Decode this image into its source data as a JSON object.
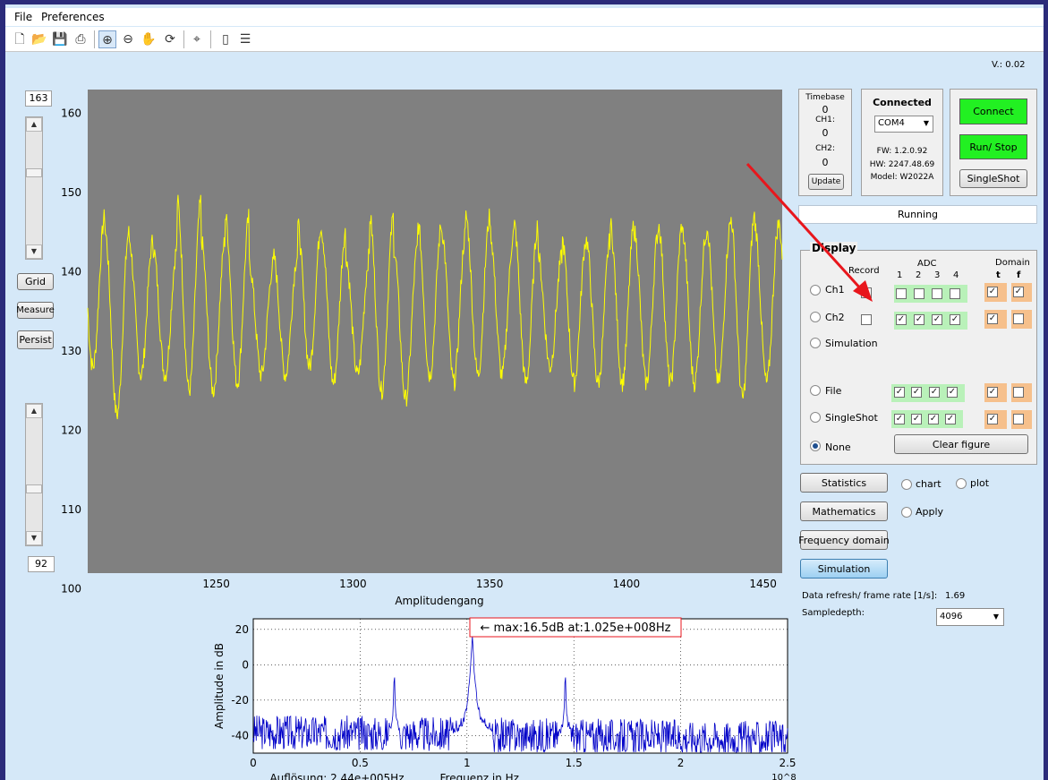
{
  "menu": [
    "File",
    "Preferences"
  ],
  "toolbar_icons": [
    "new-file-icon",
    "open-folder-icon",
    "save-icon",
    "print-icon",
    "zoom-in-icon",
    "zoom-out-icon",
    "pan-hand-icon",
    "rotate-3d-icon",
    "data-cursor-icon",
    "colorbar-icon",
    "legend-icon"
  ],
  "version": "V.: 0.02",
  "left": {
    "top_value": "163",
    "bottom_value": "92",
    "grid_label": "Grid",
    "measure_label": "Measure",
    "persist_label": "Persist"
  },
  "status": {
    "timebase_title": "Timebase",
    "timebase_value": "0",
    "ch1_label": "CH1:",
    "ch1_value": "0",
    "ch2_label": "CH2:",
    "ch2_value": "0",
    "update_label": "Update",
    "connected_label": "Connected",
    "port_value": "COM4",
    "fw": "FW: 1.2.0.92",
    "hw": "HW: 2247.48.69",
    "model": "Model: W2022A",
    "connect_label": "Connect",
    "runstop_label": "Run/ Stop",
    "singleshot_label": "SingleShot",
    "running_text": "Running"
  },
  "display": {
    "title": "Display",
    "record_header": "Record",
    "adc_header": "ADC",
    "adc_cols": [
      "1",
      "2",
      "3",
      "4"
    ],
    "domain_header": "Domain",
    "domain_t": "t",
    "domain_f": "f",
    "rows": [
      {
        "label": "Ch1",
        "selected": false,
        "record": false,
        "adc": [
          false,
          false,
          false,
          false
        ],
        "t": true,
        "f": true
      },
      {
        "label": "Ch2",
        "selected": false,
        "record": false,
        "adc": [
          true,
          true,
          true,
          true
        ],
        "t": true,
        "f": false
      },
      {
        "label": "Simulation",
        "selected": false
      },
      {
        "label": "File",
        "selected": false,
        "adc": [
          true,
          true,
          true,
          true
        ],
        "t": true,
        "f": false
      },
      {
        "label": "SingleShot",
        "selected": false,
        "adc": [
          true,
          true,
          true,
          true
        ],
        "t": true,
        "f": false
      },
      {
        "label": "None",
        "selected": true
      }
    ],
    "clear_label": "Clear figure"
  },
  "tools": {
    "statistics_label": "Statistics",
    "chart_label": "chart",
    "plot_label": "plot",
    "mathematics_label": "Mathematics",
    "apply_label": "Apply",
    "frequency_label": "Frequency domain",
    "simulation_label": "Simulation",
    "refresh_label": "Data refresh/ frame rate [1/s]:",
    "refresh_value": "1.69",
    "sampledepth_label": "Sampledepth:",
    "sampledepth_value": "4096"
  },
  "colors": {
    "plot_bg": "#808080",
    "trace": "#ffff00",
    "spectrum": "#0000c8",
    "arrow": "#e8161c",
    "green_button": "#22f022"
  },
  "chart_data": [
    {
      "type": "line",
      "title": "",
      "xlabel": "Amplitudengang",
      "ylabel": "",
      "xlim": [
        1203,
        1457
      ],
      "ylim": [
        102,
        163
      ],
      "xticks": [
        1250,
        1300,
        1350,
        1400,
        1450
      ],
      "yticks": [
        160,
        150,
        140,
        130,
        120,
        110,
        100
      ],
      "grid": false,
      "series": [
        {
          "period": 8.8,
          "center": 135,
          "peaks": [
            147,
            145,
            144,
            143,
            149,
            144,
            147,
            141,
            142,
            146,
            145,
            142,
            147,
            143,
            146,
            145,
            147,
            145,
            146,
            142,
            144,
            144,
            146,
            145,
            146,
            145,
            146,
            147,
            146
          ],
          "troughs": [
            128,
            122,
            127,
            127,
            125,
            125,
            126,
            127,
            127,
            128,
            126,
            127,
            125,
            124,
            127,
            126,
            127,
            127,
            126,
            128,
            126,
            126,
            126,
            126,
            126,
            126,
            126,
            124,
            126
          ]
        }
      ]
    },
    {
      "type": "line",
      "title": "← max:16.5dB at:1.025e+008Hz",
      "xlabel": "Frequenz in Hz",
      "xlabel_prefix": "Auflösung: 2.44e+005Hz",
      "ylabel": "Amplitude in dB",
      "x_exponent": "10^8",
      "xlim": [
        0,
        2.5
      ],
      "ylim": [
        -50,
        26
      ],
      "xticks": [
        "0",
        "0.5",
        "1",
        "1.5",
        "2",
        "2.5"
      ],
      "yticks": [
        "20",
        "0",
        "-20",
        "-40"
      ],
      "grid": true,
      "series": [
        {
          "noise_floor": -38,
          "peaks": [
            {
              "x": 1.025,
              "y": 16.5
            },
            {
              "x": 0.66,
              "y": -2
            },
            {
              "x": 1.46,
              "y": -3
            }
          ]
        }
      ]
    }
  ]
}
